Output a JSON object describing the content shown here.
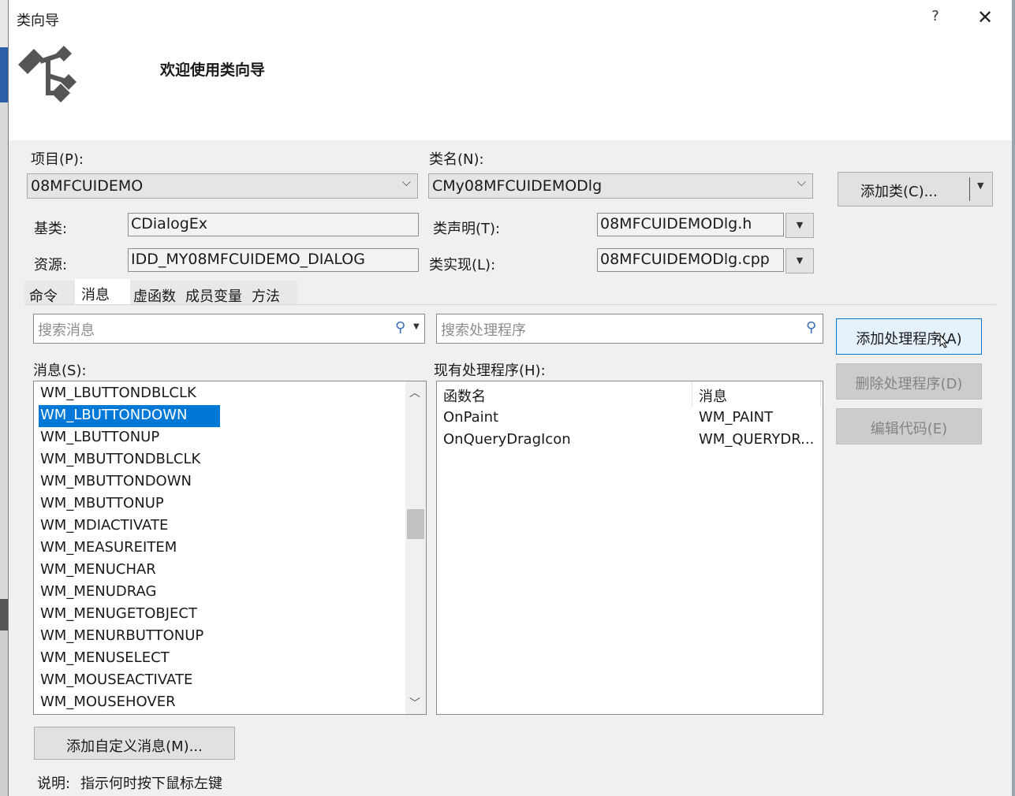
{
  "window": {
    "title": "类向导",
    "help": "?",
    "close": "✕"
  },
  "header": {
    "welcome": "欢迎使用类向导"
  },
  "form": {
    "project_label": "项目(P):",
    "project_value": "08MFCUIDEMO",
    "classname_label": "类名(N):",
    "classname_value": "CMy08MFCUIDEMODlg",
    "add_class_label": "添加类(C)...",
    "base_label": "基类:",
    "base_value": "CDialogEx",
    "decl_label": "类声明(T):",
    "decl_value": "08MFCUIDEMODlg.h",
    "resource_label": "资源:",
    "resource_value": "IDD_MY08MFCUIDEMO_DIALOG",
    "impl_label": "类实现(L):",
    "impl_value": "08MFCUIDEMODlg.cpp"
  },
  "tabs": [
    {
      "label": "命令"
    },
    {
      "label": "消息",
      "active": true
    },
    {
      "label": "虚函数"
    },
    {
      "label": "成员变量"
    },
    {
      "label": "方法"
    }
  ],
  "messages_panel": {
    "search_placeholder": "搜索消息",
    "list_label": "消息(S):",
    "items": [
      "WM_LBUTTONDBLCLK",
      "WM_LBUTTONDOWN",
      "WM_LBUTTONUP",
      "WM_MBUTTONDBLCLK",
      "WM_MBUTTONDOWN",
      "WM_MBUTTONUP",
      "WM_MDIACTIVATE",
      "WM_MEASUREITEM",
      "WM_MENUCHAR",
      "WM_MENUDRAG",
      "WM_MENUGETOBJECT",
      "WM_MENURBUTTONUP",
      "WM_MENUSELECT",
      "WM_MOUSEACTIVATE",
      "WM_MOUSEHOVER"
    ],
    "selected_index": 1,
    "add_custom_label": "添加自定义消息(M)..."
  },
  "handlers_panel": {
    "search_placeholder": "搜索处理程序",
    "list_label": "现有处理程序(H):",
    "columns": [
      "函数名",
      "消息"
    ],
    "rows": [
      [
        "OnPaint",
        "WM_PAINT"
      ],
      [
        "OnQueryDragIcon",
        "WM_QUERYDR..."
      ]
    ]
  },
  "actions": {
    "add_handler": "添加处理程序(A)",
    "delete_handler": "删除处理程序(D)",
    "edit_code": "编辑代码(E)"
  },
  "description": {
    "label": "说明:",
    "text": "指示何时按下鼠标左键"
  },
  "colors": {
    "selection": "#0078d7",
    "primary_border": "#0078d7"
  }
}
